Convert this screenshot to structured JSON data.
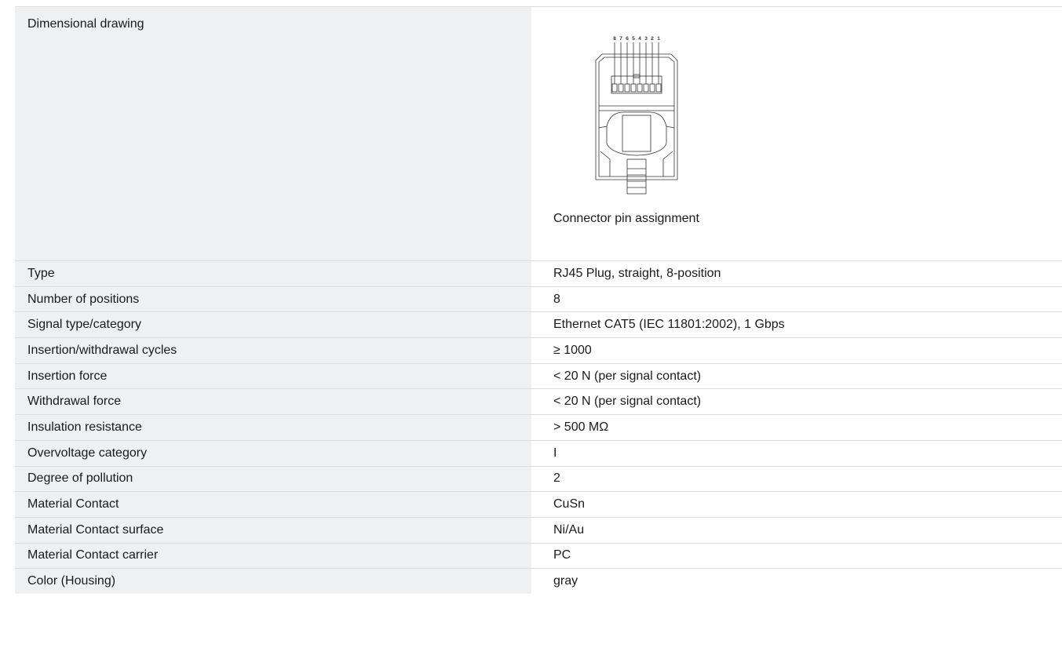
{
  "header_row": {
    "label": "Dimensional drawing",
    "drawing": {
      "pin_numbers": [
        "8",
        "7",
        "6",
        "5",
        "4",
        "3",
        "2",
        "1"
      ],
      "caption": "Connector pin assignment"
    }
  },
  "rows": [
    {
      "label": "Type",
      "value": "RJ45 Plug, straight, 8-position"
    },
    {
      "label": "Number of positions",
      "value": "8"
    },
    {
      "label": "Signal type/category",
      "value": "Ethernet CAT5 (IEC 11801:2002), 1 Gbps"
    },
    {
      "label": "Insertion/withdrawal cycles",
      "value": "≥ 1000"
    },
    {
      "label": "Insertion force",
      "value": "< 20 N (per signal contact)"
    },
    {
      "label": "Withdrawal force",
      "value": "< 20 N (per signal contact)"
    },
    {
      "label": "Insulation resistance",
      "value": "> 500 MΩ"
    },
    {
      "label": "Overvoltage category",
      "value": "I"
    },
    {
      "label": "Degree of pollution",
      "value": "2"
    },
    {
      "label": "Material Contact",
      "value": "CuSn"
    },
    {
      "label": "Material Contact surface",
      "value": "Ni/Au"
    },
    {
      "label": "Material Contact carrier",
      "value": "PC"
    },
    {
      "label": "Color (Housing)",
      "value": "gray"
    }
  ]
}
